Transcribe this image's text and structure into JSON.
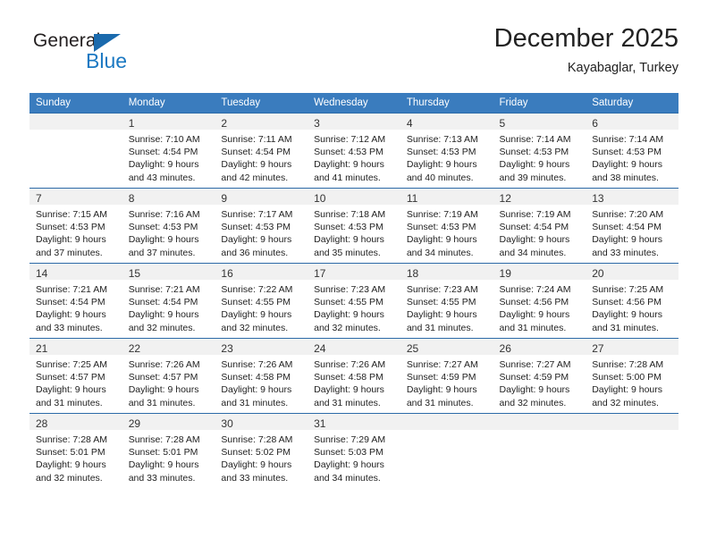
{
  "logo": {
    "word1": "General",
    "word2": "Blue",
    "triangle_color": "#1a6aad",
    "blue_color": "#1a78c2"
  },
  "header": {
    "title": "December 2025",
    "subtitle": "Kayabaglar, Turkey"
  },
  "colors": {
    "header_row_bg": "#3a7cbe",
    "daynum_band_bg": "#f1f1f1",
    "row_separator": "#2c6aa8",
    "text": "#222222"
  },
  "weekdays": [
    "Sunday",
    "Monday",
    "Tuesday",
    "Wednesday",
    "Thursday",
    "Friday",
    "Saturday"
  ],
  "weeks": [
    [
      {
        "day": "",
        "lines": []
      },
      {
        "day": "1",
        "lines": [
          "Sunrise: 7:10 AM",
          "Sunset: 4:54 PM",
          "Daylight: 9 hours",
          "and 43 minutes."
        ]
      },
      {
        "day": "2",
        "lines": [
          "Sunrise: 7:11 AM",
          "Sunset: 4:54 PM",
          "Daylight: 9 hours",
          "and 42 minutes."
        ]
      },
      {
        "day": "3",
        "lines": [
          "Sunrise: 7:12 AM",
          "Sunset: 4:53 PM",
          "Daylight: 9 hours",
          "and 41 minutes."
        ]
      },
      {
        "day": "4",
        "lines": [
          "Sunrise: 7:13 AM",
          "Sunset: 4:53 PM",
          "Daylight: 9 hours",
          "and 40 minutes."
        ]
      },
      {
        "day": "5",
        "lines": [
          "Sunrise: 7:14 AM",
          "Sunset: 4:53 PM",
          "Daylight: 9 hours",
          "and 39 minutes."
        ]
      },
      {
        "day": "6",
        "lines": [
          "Sunrise: 7:14 AM",
          "Sunset: 4:53 PM",
          "Daylight: 9 hours",
          "and 38 minutes."
        ]
      }
    ],
    [
      {
        "day": "7",
        "lines": [
          "Sunrise: 7:15 AM",
          "Sunset: 4:53 PM",
          "Daylight: 9 hours",
          "and 37 minutes."
        ]
      },
      {
        "day": "8",
        "lines": [
          "Sunrise: 7:16 AM",
          "Sunset: 4:53 PM",
          "Daylight: 9 hours",
          "and 37 minutes."
        ]
      },
      {
        "day": "9",
        "lines": [
          "Sunrise: 7:17 AM",
          "Sunset: 4:53 PM",
          "Daylight: 9 hours",
          "and 36 minutes."
        ]
      },
      {
        "day": "10",
        "lines": [
          "Sunrise: 7:18 AM",
          "Sunset: 4:53 PM",
          "Daylight: 9 hours",
          "and 35 minutes."
        ]
      },
      {
        "day": "11",
        "lines": [
          "Sunrise: 7:19 AM",
          "Sunset: 4:53 PM",
          "Daylight: 9 hours",
          "and 34 minutes."
        ]
      },
      {
        "day": "12",
        "lines": [
          "Sunrise: 7:19 AM",
          "Sunset: 4:54 PM",
          "Daylight: 9 hours",
          "and 34 minutes."
        ]
      },
      {
        "day": "13",
        "lines": [
          "Sunrise: 7:20 AM",
          "Sunset: 4:54 PM",
          "Daylight: 9 hours",
          "and 33 minutes."
        ]
      }
    ],
    [
      {
        "day": "14",
        "lines": [
          "Sunrise: 7:21 AM",
          "Sunset: 4:54 PM",
          "Daylight: 9 hours",
          "and 33 minutes."
        ]
      },
      {
        "day": "15",
        "lines": [
          "Sunrise: 7:21 AM",
          "Sunset: 4:54 PM",
          "Daylight: 9 hours",
          "and 32 minutes."
        ]
      },
      {
        "day": "16",
        "lines": [
          "Sunrise: 7:22 AM",
          "Sunset: 4:55 PM",
          "Daylight: 9 hours",
          "and 32 minutes."
        ]
      },
      {
        "day": "17",
        "lines": [
          "Sunrise: 7:23 AM",
          "Sunset: 4:55 PM",
          "Daylight: 9 hours",
          "and 32 minutes."
        ]
      },
      {
        "day": "18",
        "lines": [
          "Sunrise: 7:23 AM",
          "Sunset: 4:55 PM",
          "Daylight: 9 hours",
          "and 31 minutes."
        ]
      },
      {
        "day": "19",
        "lines": [
          "Sunrise: 7:24 AM",
          "Sunset: 4:56 PM",
          "Daylight: 9 hours",
          "and 31 minutes."
        ]
      },
      {
        "day": "20",
        "lines": [
          "Sunrise: 7:25 AM",
          "Sunset: 4:56 PM",
          "Daylight: 9 hours",
          "and 31 minutes."
        ]
      }
    ],
    [
      {
        "day": "21",
        "lines": [
          "Sunrise: 7:25 AM",
          "Sunset: 4:57 PM",
          "Daylight: 9 hours",
          "and 31 minutes."
        ]
      },
      {
        "day": "22",
        "lines": [
          "Sunrise: 7:26 AM",
          "Sunset: 4:57 PM",
          "Daylight: 9 hours",
          "and 31 minutes."
        ]
      },
      {
        "day": "23",
        "lines": [
          "Sunrise: 7:26 AM",
          "Sunset: 4:58 PM",
          "Daylight: 9 hours",
          "and 31 minutes."
        ]
      },
      {
        "day": "24",
        "lines": [
          "Sunrise: 7:26 AM",
          "Sunset: 4:58 PM",
          "Daylight: 9 hours",
          "and 31 minutes."
        ]
      },
      {
        "day": "25",
        "lines": [
          "Sunrise: 7:27 AM",
          "Sunset: 4:59 PM",
          "Daylight: 9 hours",
          "and 31 minutes."
        ]
      },
      {
        "day": "26",
        "lines": [
          "Sunrise: 7:27 AM",
          "Sunset: 4:59 PM",
          "Daylight: 9 hours",
          "and 32 minutes."
        ]
      },
      {
        "day": "27",
        "lines": [
          "Sunrise: 7:28 AM",
          "Sunset: 5:00 PM",
          "Daylight: 9 hours",
          "and 32 minutes."
        ]
      }
    ],
    [
      {
        "day": "28",
        "lines": [
          "Sunrise: 7:28 AM",
          "Sunset: 5:01 PM",
          "Daylight: 9 hours",
          "and 32 minutes."
        ]
      },
      {
        "day": "29",
        "lines": [
          "Sunrise: 7:28 AM",
          "Sunset: 5:01 PM",
          "Daylight: 9 hours",
          "and 33 minutes."
        ]
      },
      {
        "day": "30",
        "lines": [
          "Sunrise: 7:28 AM",
          "Sunset: 5:02 PM",
          "Daylight: 9 hours",
          "and 33 minutes."
        ]
      },
      {
        "day": "31",
        "lines": [
          "Sunrise: 7:29 AM",
          "Sunset: 5:03 PM",
          "Daylight: 9 hours",
          "and 34 minutes."
        ]
      },
      {
        "day": "",
        "lines": []
      },
      {
        "day": "",
        "lines": []
      },
      {
        "day": "",
        "lines": []
      }
    ]
  ]
}
